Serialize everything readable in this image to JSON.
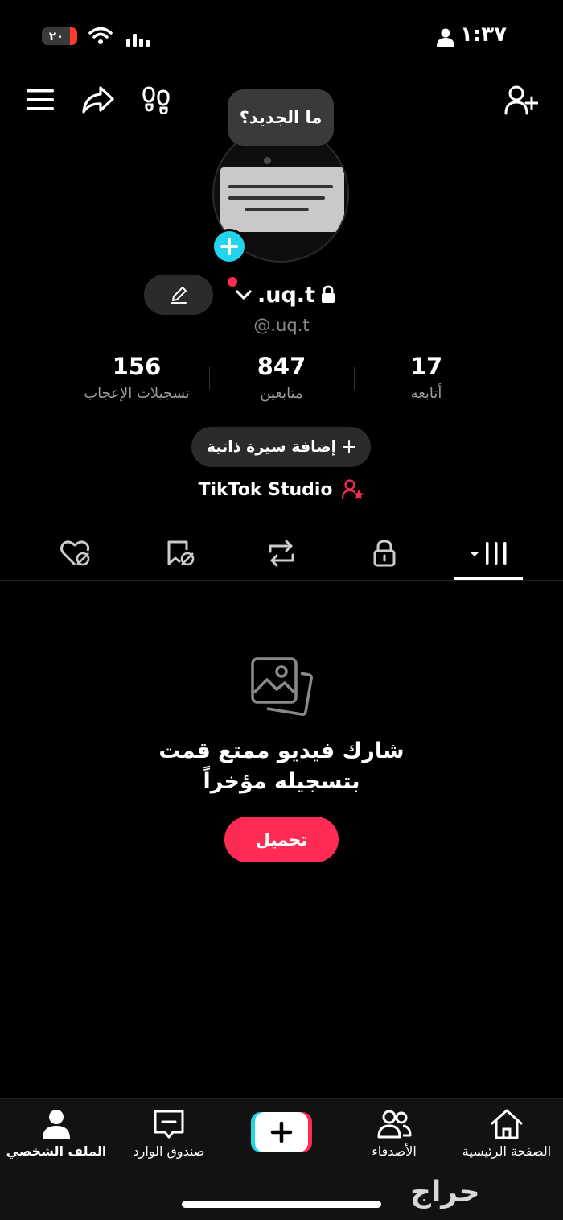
{
  "status_bar": {
    "time": "١:٣٧",
    "battery": "٢٠"
  },
  "tooltip": {
    "text": "ما الجديد؟"
  },
  "profile": {
    "display_name": ".uq.t",
    "handle": "@.uq.t",
    "stats": {
      "likes": {
        "value": "156",
        "label": "تسجيلات الإعجاب"
      },
      "followers": {
        "value": "847",
        "label": "متابعين"
      },
      "following": {
        "value": "17",
        "label": "أتابعه"
      }
    },
    "add_bio_label": "إضافة سيرة ذاتية",
    "studio_label": "TikTok Studio"
  },
  "tabs": [
    "videos-grid",
    "private",
    "reposts",
    "favorites",
    "liked"
  ],
  "empty_state": {
    "line1": "شارك فيديو ممتع قمت",
    "line2": "بتسجيله مؤخراً",
    "button": "تحميل"
  },
  "bottom_nav": {
    "home": "الصفحة الرئيسية",
    "friends": "الأصدقاء",
    "inbox": "صندوق الوارد",
    "profile": "الملف الشخصي"
  },
  "watermark": "حراج",
  "colors": {
    "accent": "#fe2c55",
    "cyan": "#20d5ec",
    "background": "#000000"
  }
}
